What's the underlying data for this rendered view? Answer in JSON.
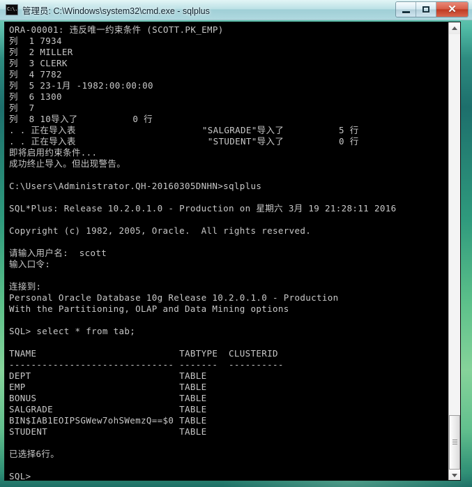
{
  "window": {
    "title": "管理员: C:\\Windows\\system32\\cmd.exe - sqlplus",
    "icon": "cmd-icon",
    "minimize_label": "",
    "maximize_label": "",
    "close_label": "✕",
    "frame_color": "#2f8f75",
    "titlebar_color": "#c6e4ec",
    "close_button_color": "#bf3a22"
  },
  "console": {
    "background_color": "#000000",
    "text_color": "#c8c8c8",
    "font_size_px": 12.5,
    "line_height_px": 16,
    "lines": [
      "ORA-00001: 违反唯一约束条件 (SCOTT.PK_EMP)",
      "列  1 7934",
      "列  2 MILLER",
      "列  3 CLERK",
      "列  4 7782",
      "列  5 23-1月 -1982:00:00:00",
      "列  6 1300",
      "列  7",
      "列  8 10导入了          0 行",
      ". . 正在导入表                       \"SALGRADE\"导入了          5 行",
      ". . 正在导入表                        \"STUDENT\"导入了          0 行",
      "即将启用约束条件...",
      "成功终止导入。但出现警告。",
      "",
      "C:\\Users\\Administrator.QH-20160305DNHN>sqlplus",
      "",
      "SQL*Plus: Release 10.2.0.1.0 - Production on 星期六 3月 19 21:28:11 2016",
      "",
      "Copyright (c) 1982, 2005, Oracle.  All rights reserved.",
      "",
      "请输入用户名:  scott",
      "输入口令:",
      "",
      "连接到:",
      "Personal Oracle Database 10g Release 10.2.0.1.0 - Production",
      "With the Partitioning, OLAP and Data Mining options",
      "",
      "SQL> select * from tab;",
      "",
      "TNAME                          TABTYPE  CLUSTERID",
      "------------------------------ -------  ----------",
      "DEPT                           TABLE",
      "EMP                            TABLE",
      "BONUS                          TABLE",
      "SALGRADE                       TABLE",
      "BIN$IAB1EOIPSGWew7ohSWemzQ==$0 TABLE",
      "STUDENT                        TABLE",
      "",
      "已选择6行。",
      "",
      "SQL>"
    ]
  },
  "scrollbar": {
    "up_arrow": "▲",
    "down_arrow": "▼",
    "thumb_position": "bottom"
  }
}
